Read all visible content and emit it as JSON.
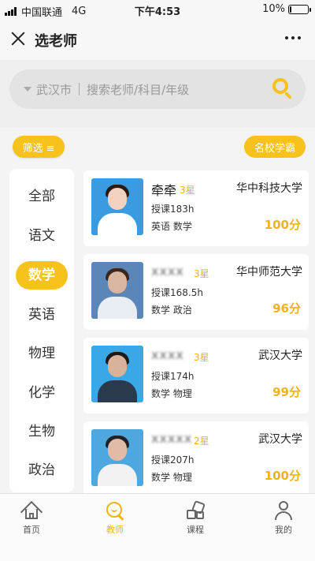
{
  "status_bar": {
    "carrier": "中国联通",
    "network": "4G",
    "time": "下午4:53",
    "battery_text": "10%",
    "battery_level": 0.1
  },
  "nav": {
    "title": "选老师"
  },
  "search": {
    "city": "武汉市",
    "placeholder": "搜索老师/科目/年级",
    "accent": "#f6c21b"
  },
  "filter": {
    "label": "筛选 ≡",
    "famous_label": "名校学霸"
  },
  "subjects": [
    {
      "label": "全部",
      "active": false
    },
    {
      "label": "语文",
      "active": false
    },
    {
      "label": "数学",
      "active": true
    },
    {
      "label": "英语",
      "active": false
    },
    {
      "label": "物理",
      "active": false
    },
    {
      "label": "化学",
      "active": false
    },
    {
      "label": "生物",
      "active": false
    },
    {
      "label": "政治",
      "active": false
    }
  ],
  "teachers": [
    {
      "name": "牵牵",
      "level": "3星",
      "school": "华中科技大学",
      "hours": "授课183h",
      "subjects": "英语 数学",
      "score": "100分"
    },
    {
      "name": "xxxx",
      "level": "3星",
      "school": "华中师范大学",
      "hours": "授课168.5h",
      "subjects": "数学 政治",
      "score": "96分"
    },
    {
      "name": "xxxx",
      "level": "3星",
      "school": "武汉大学",
      "hours": "授课174h",
      "subjects": "数学 物理",
      "score": "99分"
    },
    {
      "name": "xxxxx",
      "level": "2星",
      "school": "武汉大学",
      "hours": "授课207h",
      "subjects": "数学 物理",
      "score": "100分"
    }
  ],
  "tabs": [
    {
      "label": "首页",
      "icon": "home-icon",
      "active": false
    },
    {
      "label": "教师",
      "icon": "teacher-search-icon",
      "active": true
    },
    {
      "label": "课程",
      "icon": "course-icon",
      "active": false
    },
    {
      "label": "我的",
      "icon": "user-icon",
      "active": false
    }
  ],
  "colors": {
    "accent": "#f6c21b",
    "level_text": "#f3b21b"
  }
}
